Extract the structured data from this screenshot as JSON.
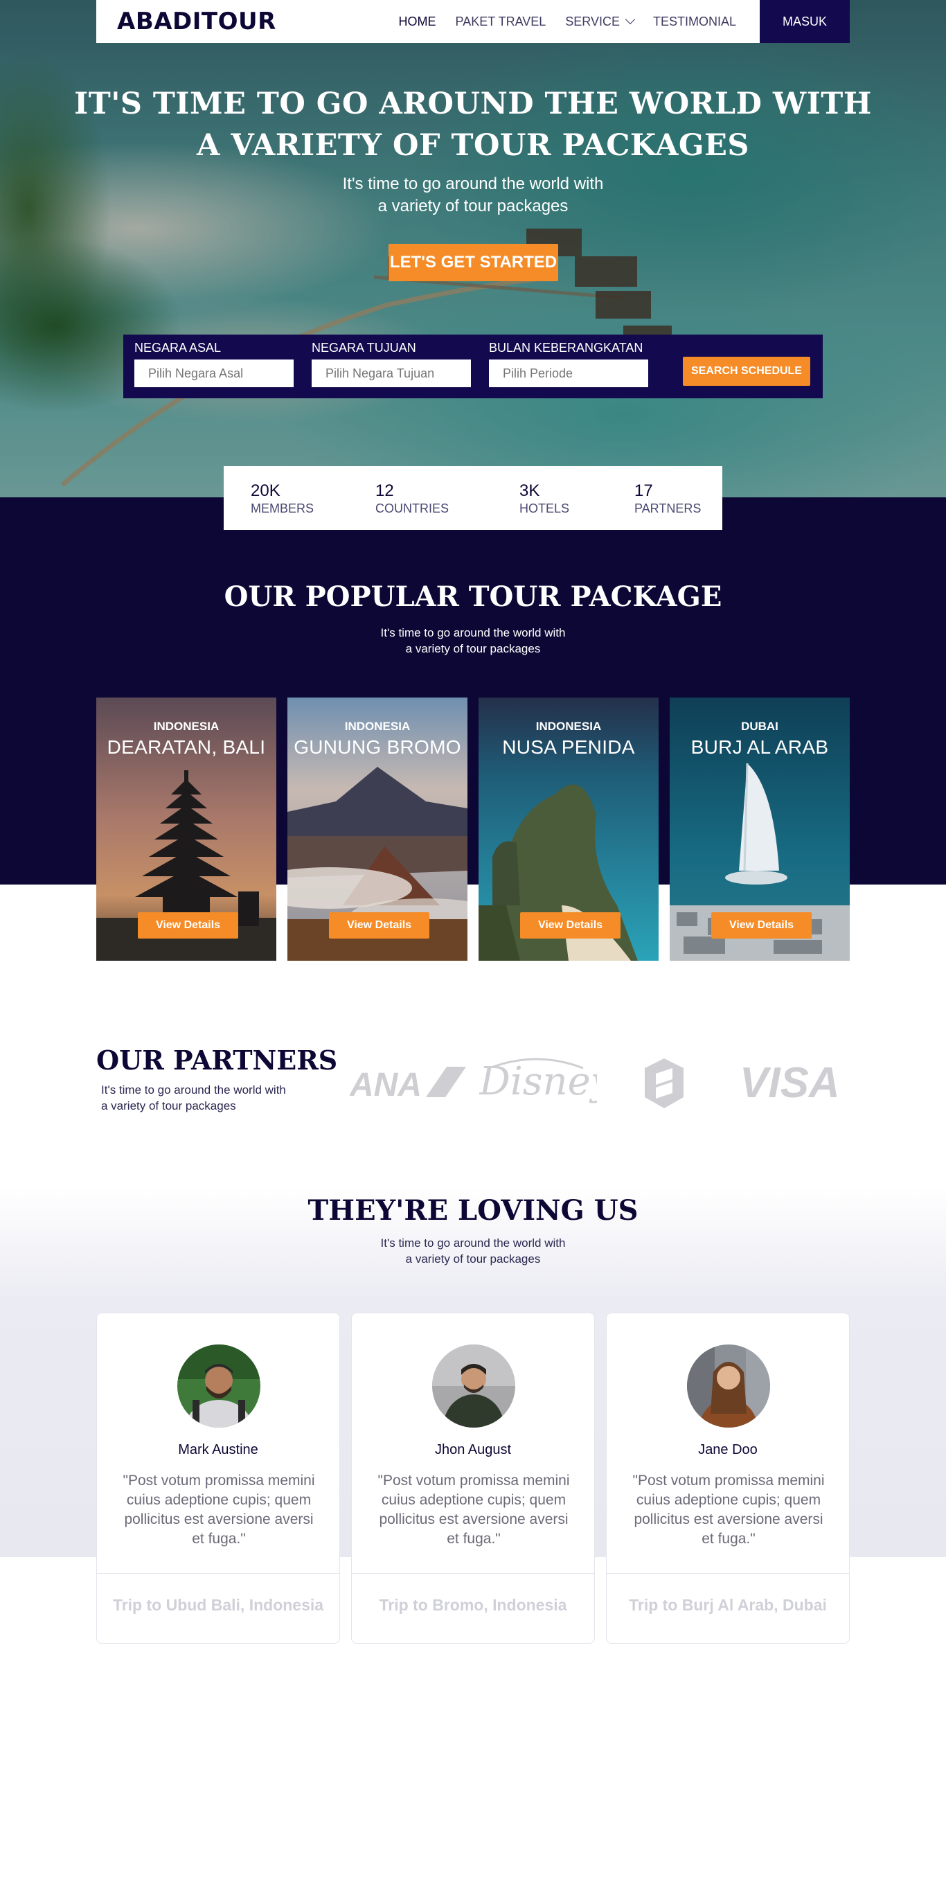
{
  "nav": {
    "logo": "ABADITOUR",
    "links": [
      {
        "label": "HOME"
      },
      {
        "label": "PAKET TRAVEL"
      },
      {
        "label": "SERVICE"
      },
      {
        "label": "TESTIMONIAL"
      }
    ],
    "login_label": "MASUK"
  },
  "hero": {
    "title_line1": "IT'S TIME TO GO AROUND THE WORLD WITH",
    "title_line2": "A VARIETY OF TOUR PACKAGES",
    "subtitle": "It's time to go around the world with\na variety of tour packages",
    "cta_label": "LET'S GET STARTED"
  },
  "search": {
    "fields": [
      {
        "label": "NEGARA ASAL",
        "placeholder": "Pilih Negara Asal"
      },
      {
        "label": "NEGARA TUJUAN",
        "placeholder": "Pilih Negara Tujuan"
      },
      {
        "label": "BULAN KEBERANGKATAN",
        "placeholder": "Pilih Periode"
      }
    ],
    "button_label": "SEARCH SCHEDULE"
  },
  "stats": [
    {
      "value": "20K",
      "label": "MEMBERS"
    },
    {
      "value": "12",
      "label": "COUNTRIES"
    },
    {
      "value": "3K",
      "label": "HOTELS"
    },
    {
      "value": "17",
      "label": "PARTNERS"
    }
  ],
  "popular": {
    "title": "OUR POPULAR TOUR PACKAGE",
    "subtitle": "It's time to go around the world with\na variety of tour packages",
    "cards": [
      {
        "country": "INDONESIA",
        "name": "DEARATAN, BALI",
        "button": "View Details"
      },
      {
        "country": "INDONESIA",
        "name": "GUNUNG BROMO",
        "button": "View Details"
      },
      {
        "country": "INDONESIA",
        "name": "NUSA PENIDA",
        "button": "View Details"
      },
      {
        "country": "DUBAI",
        "name": "BURJ AL ARAB",
        "button": "View Details"
      }
    ]
  },
  "partners": {
    "title": "OUR PARTNERS",
    "subtitle": "It's time to go around the world with\na variety of tour packages",
    "logos": [
      "ANA",
      "Disney",
      "Shield",
      "VISA"
    ]
  },
  "testimonials": {
    "title": "THEY'RE LOVING US",
    "subtitle": "It's time to go around the world with\na variety of tour packages",
    "items": [
      {
        "name": "Mark Austine",
        "quote": "\"Post votum promissa memini cuius adeptione cupis; quem pollicitus est aversione aversi et fuga.\"",
        "trip": "Trip to Ubud Bali, Indonesia"
      },
      {
        "name": "Jhon August",
        "quote": "\"Post votum promissa memini cuius adeptione cupis; quem pollicitus est aversione aversi et fuga.\"",
        "trip": "Trip to Bromo, Indonesia"
      },
      {
        "name": "Jane Doo",
        "quote": "\"Post votum promissa memini cuius adeptione cupis; quem pollicitus est aversione aversi et fuga.\"",
        "trip": "Trip to Burj Al Arab, Dubai"
      }
    ]
  },
  "colors": {
    "navy": "#0d0735",
    "navy_button": "#13094e",
    "accent_orange": "#f58c27"
  }
}
